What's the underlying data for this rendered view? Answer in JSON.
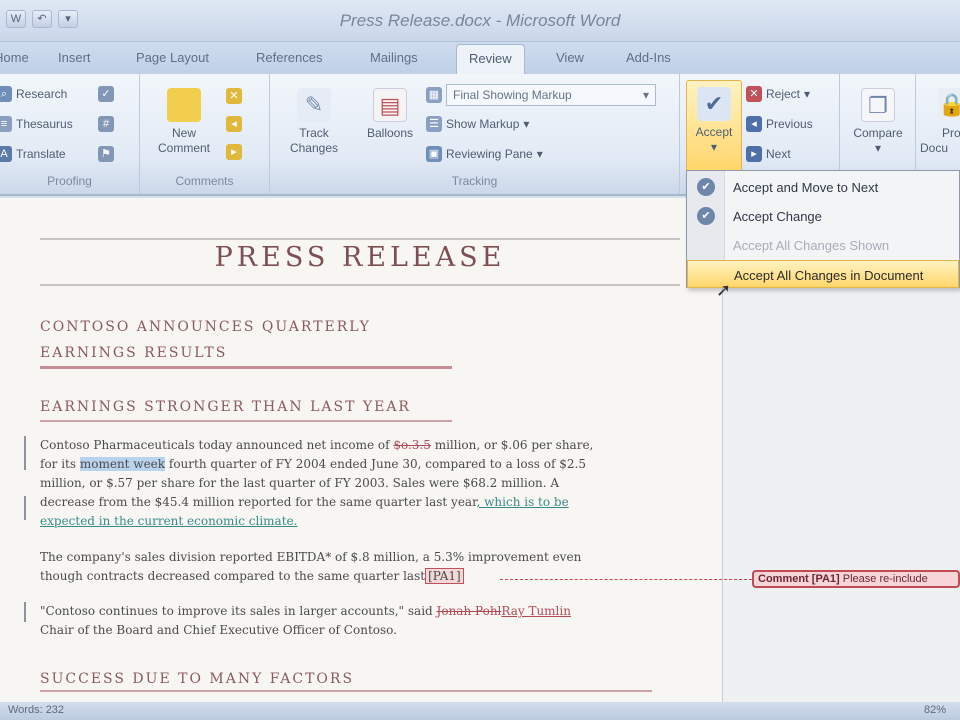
{
  "window": {
    "title": "Press Release.docx - Microsoft Word"
  },
  "qat": [
    "W",
    "↶",
    "▾"
  ],
  "tabs": [
    "Home",
    "Insert",
    "Page Layout",
    "References",
    "Mailings",
    "Review",
    "View",
    "Add-Ins"
  ],
  "active_tab": "Review",
  "ribbon": {
    "proofing": {
      "items": [
        "Research",
        "Thesaurus",
        "Translate"
      ],
      "label": "Proofing"
    },
    "comments": {
      "new_comment": "New\nComment",
      "label": "Comments"
    },
    "tracking": {
      "track_changes": "Track\nChanges",
      "balloons": "Balloons",
      "display_mode": "Final Showing Markup",
      "show_markup": "Show Markup",
      "reviewing_pane": "Reviewing Pane",
      "label": "Tracking"
    },
    "changes": {
      "accept": "Accept",
      "reject": "Reject",
      "previous": "Previous",
      "next": "Next"
    },
    "compare": {
      "label": "Compare"
    },
    "protect": {
      "label": "Pro\nDocu"
    }
  },
  "accept_menu": {
    "items": [
      {
        "label": "Accept and Move to Next",
        "state": "normal"
      },
      {
        "label": "Accept Change",
        "state": "normal"
      },
      {
        "label": "Accept All Changes Shown",
        "state": "disabled"
      },
      {
        "label": "Accept All Changes in Document",
        "state": "highlighted"
      }
    ]
  },
  "document": {
    "title": "PRESS RELEASE",
    "heading1_line1": "CONTOSO ANNOUNCES QUARTERLY",
    "heading1_line2": "EARNINGS RESULTS",
    "heading2": "EARNINGS STRONGER THAN LAST YEAR",
    "p1": {
      "a": "Contoso Pharmaceuticals today announced net income of ",
      "del1": "$o.3.5",
      "b": " million, or $.06 per share,",
      "c": "for its ",
      "sel": "moment week",
      "d": " fourth quarter of FY 2004 ended June 30, compared to a loss of $2.5",
      "e": "million, or $.57 per share for the last quarter of FY 2003. Sales were $68.2 million. A",
      "f": "decrease from the $45.4 million reported for the same quarter last year",
      "ins1": ", which is to be",
      "ins2": "expected in the current economic climate."
    },
    "p2": {
      "a": "The company's sales division reported EBITDA* of $.8 million, a 5.3% improvement even",
      "b": "though contracts decreased compared to the same quarter last",
      "cmt": "[PA1]"
    },
    "p3": {
      "a": "\"Contoso continues to improve its sales in larger accounts,\" said ",
      "del": "Jonah Pohl",
      "ins": "Ray Tumlin",
      "b": "Chair of the Board and Chief Executive Officer of Contoso."
    },
    "heading3": "SUCCESS DUE TO MANY FACTORS"
  },
  "comment_balloon": {
    "label": "Comment",
    "id": "[PA1]",
    "text": "Please re-include"
  },
  "status": {
    "words": "Words: 232",
    "zoom": "82%"
  },
  "colors": {
    "accent": "#ffd66b",
    "deletion": "#b04a55",
    "insertion": "#3a8a8a"
  }
}
